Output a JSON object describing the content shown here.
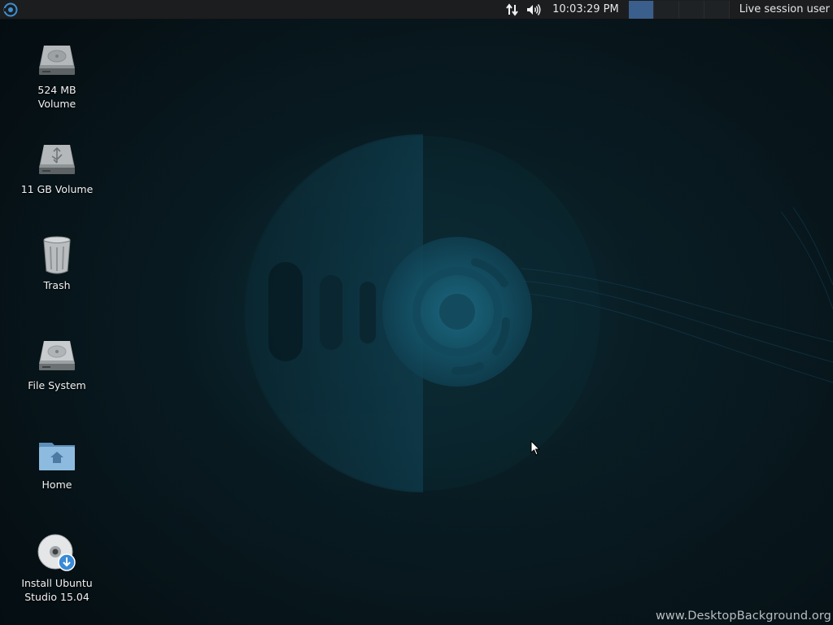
{
  "panel": {
    "menu_icon": "ubuntu-studio-logo-icon",
    "network_icon": "network-arrows-icon",
    "volume_icon": "speaker-volume-icon",
    "clock": "10:03:29 PM",
    "workspaces": [
      {
        "active": true
      },
      {
        "active": false
      },
      {
        "active": false
      },
      {
        "active": false
      }
    ],
    "session_user": "Live session user"
  },
  "desktop_icons": [
    {
      "label": "524 MB\nVolume",
      "icon": "hard-drive-icon"
    },
    {
      "label": "11 GB Volume",
      "icon": "usb-drive-icon"
    },
    {
      "label": "Trash",
      "icon": "trash-icon"
    },
    {
      "label": "File System",
      "icon": "hard-drive-icon"
    },
    {
      "label": "Home",
      "icon": "home-folder-icon"
    },
    {
      "label": "Install Ubuntu\nStudio 15.04",
      "icon": "install-disc-icon"
    }
  ],
  "watermark": "www.DesktopBackground.org",
  "colors": {
    "panel_bg": "#1b1d1f",
    "active_workspace": "#3b5f8c",
    "wallpaper_accent": "#1e6f8a"
  }
}
